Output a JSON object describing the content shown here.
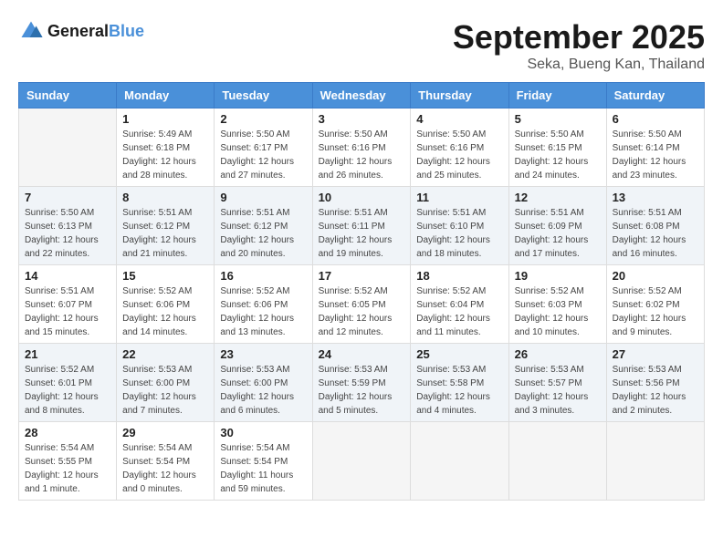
{
  "header": {
    "logo_line1": "General",
    "logo_line2": "Blue",
    "month": "September 2025",
    "location": "Seka, Bueng Kan, Thailand"
  },
  "weekdays": [
    "Sunday",
    "Monday",
    "Tuesday",
    "Wednesday",
    "Thursday",
    "Friday",
    "Saturday"
  ],
  "weeks": [
    [
      {
        "day": "",
        "info": ""
      },
      {
        "day": "1",
        "info": "Sunrise: 5:49 AM\nSunset: 6:18 PM\nDaylight: 12 hours\nand 28 minutes."
      },
      {
        "day": "2",
        "info": "Sunrise: 5:50 AM\nSunset: 6:17 PM\nDaylight: 12 hours\nand 27 minutes."
      },
      {
        "day": "3",
        "info": "Sunrise: 5:50 AM\nSunset: 6:16 PM\nDaylight: 12 hours\nand 26 minutes."
      },
      {
        "day": "4",
        "info": "Sunrise: 5:50 AM\nSunset: 6:16 PM\nDaylight: 12 hours\nand 25 minutes."
      },
      {
        "day": "5",
        "info": "Sunrise: 5:50 AM\nSunset: 6:15 PM\nDaylight: 12 hours\nand 24 minutes."
      },
      {
        "day": "6",
        "info": "Sunrise: 5:50 AM\nSunset: 6:14 PM\nDaylight: 12 hours\nand 23 minutes."
      }
    ],
    [
      {
        "day": "7",
        "info": "Sunrise: 5:50 AM\nSunset: 6:13 PM\nDaylight: 12 hours\nand 22 minutes."
      },
      {
        "day": "8",
        "info": "Sunrise: 5:51 AM\nSunset: 6:12 PM\nDaylight: 12 hours\nand 21 minutes."
      },
      {
        "day": "9",
        "info": "Sunrise: 5:51 AM\nSunset: 6:12 PM\nDaylight: 12 hours\nand 20 minutes."
      },
      {
        "day": "10",
        "info": "Sunrise: 5:51 AM\nSunset: 6:11 PM\nDaylight: 12 hours\nand 19 minutes."
      },
      {
        "day": "11",
        "info": "Sunrise: 5:51 AM\nSunset: 6:10 PM\nDaylight: 12 hours\nand 18 minutes."
      },
      {
        "day": "12",
        "info": "Sunrise: 5:51 AM\nSunset: 6:09 PM\nDaylight: 12 hours\nand 17 minutes."
      },
      {
        "day": "13",
        "info": "Sunrise: 5:51 AM\nSunset: 6:08 PM\nDaylight: 12 hours\nand 16 minutes."
      }
    ],
    [
      {
        "day": "14",
        "info": "Sunrise: 5:51 AM\nSunset: 6:07 PM\nDaylight: 12 hours\nand 15 minutes."
      },
      {
        "day": "15",
        "info": "Sunrise: 5:52 AM\nSunset: 6:06 PM\nDaylight: 12 hours\nand 14 minutes."
      },
      {
        "day": "16",
        "info": "Sunrise: 5:52 AM\nSunset: 6:06 PM\nDaylight: 12 hours\nand 13 minutes."
      },
      {
        "day": "17",
        "info": "Sunrise: 5:52 AM\nSunset: 6:05 PM\nDaylight: 12 hours\nand 12 minutes."
      },
      {
        "day": "18",
        "info": "Sunrise: 5:52 AM\nSunset: 6:04 PM\nDaylight: 12 hours\nand 11 minutes."
      },
      {
        "day": "19",
        "info": "Sunrise: 5:52 AM\nSunset: 6:03 PM\nDaylight: 12 hours\nand 10 minutes."
      },
      {
        "day": "20",
        "info": "Sunrise: 5:52 AM\nSunset: 6:02 PM\nDaylight: 12 hours\nand 9 minutes."
      }
    ],
    [
      {
        "day": "21",
        "info": "Sunrise: 5:52 AM\nSunset: 6:01 PM\nDaylight: 12 hours\nand 8 minutes."
      },
      {
        "day": "22",
        "info": "Sunrise: 5:53 AM\nSunset: 6:00 PM\nDaylight: 12 hours\nand 7 minutes."
      },
      {
        "day": "23",
        "info": "Sunrise: 5:53 AM\nSunset: 6:00 PM\nDaylight: 12 hours\nand 6 minutes."
      },
      {
        "day": "24",
        "info": "Sunrise: 5:53 AM\nSunset: 5:59 PM\nDaylight: 12 hours\nand 5 minutes."
      },
      {
        "day": "25",
        "info": "Sunrise: 5:53 AM\nSunset: 5:58 PM\nDaylight: 12 hours\nand 4 minutes."
      },
      {
        "day": "26",
        "info": "Sunrise: 5:53 AM\nSunset: 5:57 PM\nDaylight: 12 hours\nand 3 minutes."
      },
      {
        "day": "27",
        "info": "Sunrise: 5:53 AM\nSunset: 5:56 PM\nDaylight: 12 hours\nand 2 minutes."
      }
    ],
    [
      {
        "day": "28",
        "info": "Sunrise: 5:54 AM\nSunset: 5:55 PM\nDaylight: 12 hours\nand 1 minute."
      },
      {
        "day": "29",
        "info": "Sunrise: 5:54 AM\nSunset: 5:54 PM\nDaylight: 12 hours\nand 0 minutes."
      },
      {
        "day": "30",
        "info": "Sunrise: 5:54 AM\nSunset: 5:54 PM\nDaylight: 11 hours\nand 59 minutes."
      },
      {
        "day": "",
        "info": ""
      },
      {
        "day": "",
        "info": ""
      },
      {
        "day": "",
        "info": ""
      },
      {
        "day": "",
        "info": ""
      }
    ]
  ]
}
